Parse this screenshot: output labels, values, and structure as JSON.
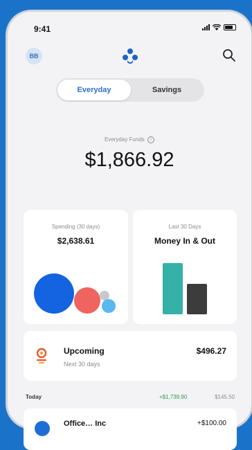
{
  "status_bar": {
    "time": "9:41"
  },
  "header": {
    "avatar_initials": "BB"
  },
  "segment": {
    "tabs": [
      "Everyday",
      "Savings"
    ],
    "selected": "Everyday"
  },
  "funds": {
    "label": "Everyday Funds",
    "amount": "$1,866.92"
  },
  "spending_card": {
    "label": "Spending (30 days)",
    "amount": "$2,638.61",
    "bubble_colors": [
      "#1463e0",
      "#ef6461",
      "#c8c8cc",
      "#5ab8f0"
    ]
  },
  "money_card": {
    "label": "Last 30 Days",
    "title": "Money In & Out",
    "bar_colors": [
      "#35b1a8",
      "#3c3c3c"
    ]
  },
  "upcoming": {
    "title": "Upcoming",
    "subtitle": "Next 30 days",
    "amount": "$496.27"
  },
  "today": {
    "label": "Today",
    "money_in": "+$1,739.90",
    "money_out": "$145.50"
  },
  "transaction": {
    "name": "Office… Inc",
    "amount": "+$100.00"
  },
  "colors": {
    "accent": "#2f6fd0",
    "background": "#1a73c9",
    "positive": "#2e9b4f"
  }
}
